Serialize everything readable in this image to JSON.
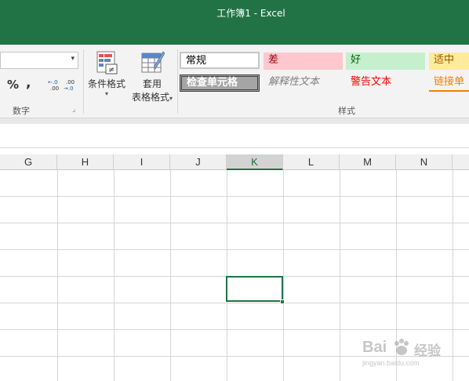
{
  "window": {
    "title": "工作簿1 - Excel"
  },
  "ribbon": {
    "number_group": {
      "label": "数字",
      "percent": "%",
      "comma": ",",
      "inc_decimal": ".00 ←.0",
      "dec_decimal": ".00 →.0"
    },
    "conditional_format": {
      "label": "条件格式",
      "sub": "▾"
    },
    "table_format": {
      "label_line1": "套用",
      "label_line2": "表格格式",
      "sub": "▾"
    },
    "styles_group": {
      "label": "样式",
      "cells": [
        {
          "label": "常规",
          "bg": "#ffffff",
          "fg": "#000000"
        },
        {
          "label": "差",
          "bg": "#ffc7ce",
          "fg": "#9c0006"
        },
        {
          "label": "好",
          "bg": "#c6efce",
          "fg": "#006100"
        },
        {
          "label": "适中",
          "bg": "#ffeb9c",
          "fg": "#9c5700"
        },
        {
          "label": "检查单元格",
          "bg": "#a5a5a5",
          "fg": "#ffffff"
        },
        {
          "label": "解释性文本",
          "bg": "#f3f3f3",
          "fg": "#7f7f7f"
        },
        {
          "label": "警告文本",
          "bg": "#f3f3f3",
          "fg": "#ff0000"
        },
        {
          "label": "链接单",
          "bg": "#f3f3f3",
          "fg": "#fa7d00"
        }
      ]
    }
  },
  "sheet": {
    "columns": [
      "G",
      "H",
      "I",
      "J",
      "K",
      "L",
      "M",
      "N"
    ],
    "selected_column": "K"
  },
  "watermark": {
    "brand": "Bai",
    "brand2": "经验",
    "url": "jingyan.baidu.com"
  },
  "colors": {
    "excel_green": "#217346"
  }
}
